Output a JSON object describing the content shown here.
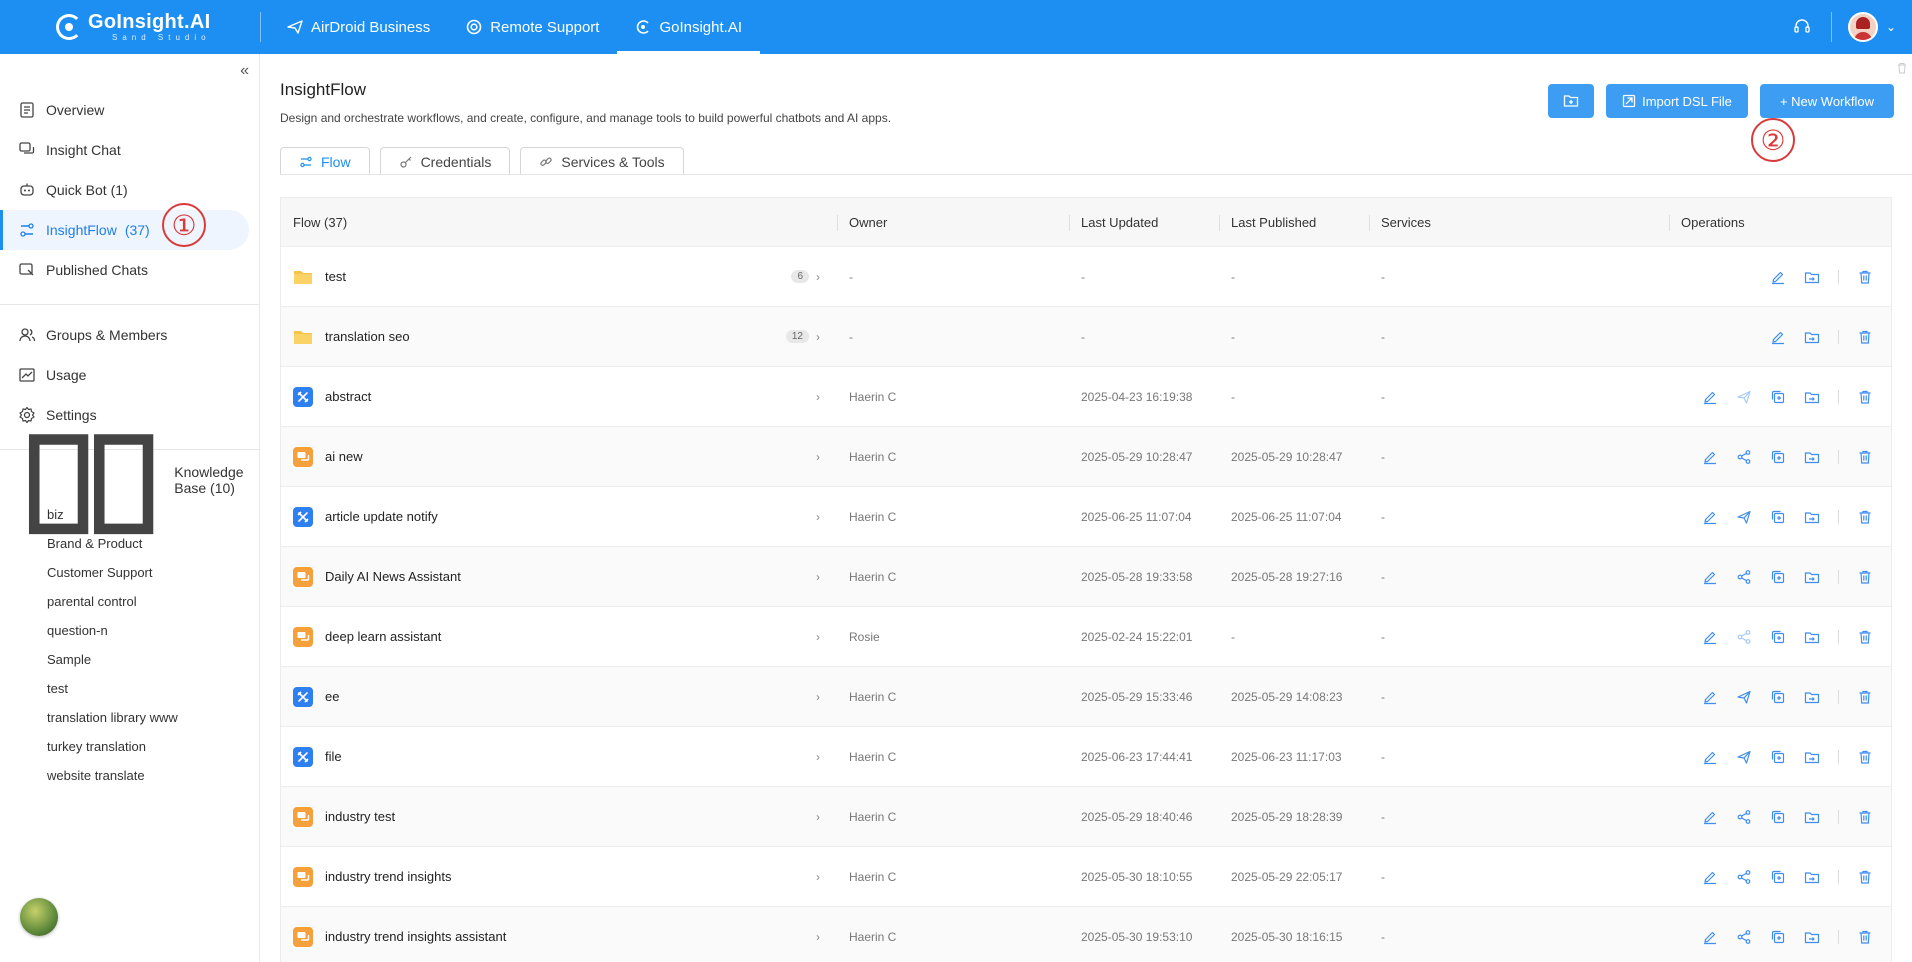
{
  "topbar": {
    "brand_name": "GoInsight.AI",
    "brand_sub": "Sand Studio",
    "nav": [
      {
        "label": "AirDroid Business",
        "icon": "plane-icon"
      },
      {
        "label": "Remote Support",
        "icon": "lifebuoy-icon"
      },
      {
        "label": "GoInsight.AI",
        "icon": "goinsight-logo-icon",
        "active": true
      }
    ]
  },
  "sidebar": {
    "items": [
      {
        "label": "Overview",
        "icon": "document-list-icon"
      },
      {
        "label": "Insight Chat",
        "icon": "chat-bubbles-icon"
      },
      {
        "label": "Quick Bot (1)",
        "icon": "robot-icon"
      },
      {
        "label": "InsightFlow",
        "count": "(37)",
        "icon": "flow-icon",
        "active": true
      },
      {
        "label": "Published Chats",
        "icon": "share-chat-icon"
      },
      {
        "label": "Groups & Members",
        "icon": "users-icon"
      },
      {
        "label": "Usage",
        "icon": "chart-icon"
      },
      {
        "label": "Settings",
        "icon": "gear-icon"
      }
    ],
    "kb_title": "Knowledge Base (10)",
    "kb_items": [
      "biz",
      "Brand & Product",
      "Customer Support",
      "parental control",
      "question-n",
      "Sample",
      "test",
      "translation library www",
      "turkey translation",
      "website translate"
    ]
  },
  "annotations": {
    "one": "①",
    "two": "②"
  },
  "main": {
    "title": "InsightFlow",
    "description": "Design and orchestrate workflows, and create, configure, and manage tools to build powerful chatbots and AI apps.",
    "import_label": "Import DSL File",
    "new_label": "+ New Workflow",
    "tabs": [
      "Flow",
      "Credentials",
      "Services & Tools"
    ]
  },
  "table": {
    "headers": [
      "Flow (37)",
      "Owner",
      "Last Updated",
      "Last Published",
      "Services",
      "Operations"
    ],
    "rows": [
      {
        "type": "folder",
        "name": "test",
        "badge": "6",
        "owner": "-",
        "updated": "-",
        "published": "-",
        "services": "-"
      },
      {
        "type": "folder",
        "name": "translation seo",
        "badge": "12",
        "owner": "-",
        "updated": "-",
        "published": "-",
        "services": "-"
      },
      {
        "type": "tool",
        "name": "abstract",
        "owner": "Haerin C",
        "updated": "2025-04-23 16:19:38",
        "published": "-",
        "services": "-"
      },
      {
        "type": "chat",
        "name": "ai new",
        "owner": "Haerin C",
        "updated": "2025-05-29 10:28:47",
        "published": "2025-05-29 10:28:47",
        "services": "-"
      },
      {
        "type": "tool",
        "name": "article update notify",
        "owner": "Haerin C",
        "updated": "2025-06-25 11:07:04",
        "published": "2025-06-25 11:07:04",
        "services": "-"
      },
      {
        "type": "chat",
        "name": "Daily AI News Assistant",
        "owner": "Haerin C",
        "updated": "2025-05-28 19:33:58",
        "published": "2025-05-28 19:27:16",
        "services": "-"
      },
      {
        "type": "chat",
        "name": "deep learn assistant",
        "owner": "Rosie",
        "updated": "2025-02-24 15:22:01",
        "published": "-",
        "services": "-"
      },
      {
        "type": "tool",
        "name": "ee",
        "owner": "Haerin C",
        "updated": "2025-05-29 15:33:46",
        "published": "2025-05-29 14:08:23",
        "services": "-"
      },
      {
        "type": "tool",
        "name": "file",
        "owner": "Haerin C",
        "updated": "2025-06-23 17:44:41",
        "published": "2025-06-23 11:17:03",
        "services": "-"
      },
      {
        "type": "chat",
        "name": "industry test",
        "owner": "Haerin C",
        "updated": "2025-05-29 18:40:46",
        "published": "2025-05-29 18:28:39",
        "services": "-"
      },
      {
        "type": "chat",
        "name": "industry trend insights",
        "owner": "Haerin C",
        "updated": "2025-05-30 18:10:55",
        "published": "2025-05-29 22:05:17",
        "services": "-"
      },
      {
        "type": "chat",
        "name": "industry trend insights assistant",
        "owner": "Haerin C",
        "updated": "2025-05-30 19:53:10",
        "published": "2025-05-30 18:16:15",
        "services": "-"
      }
    ]
  },
  "colors": {
    "brand": "#1d8ff2",
    "tool": "#2e7ff0",
    "chat": "#f5a03a",
    "annotation": "#d93b3b"
  }
}
